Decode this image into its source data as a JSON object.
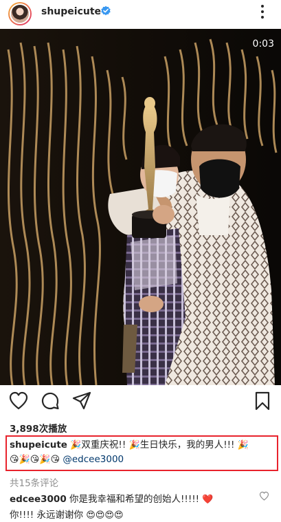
{
  "post": {
    "username": "shupeicute",
    "video_time": "0:03"
  },
  "stats": {
    "plays": "3,898次播放"
  },
  "caption": {
    "username": "shupeicute",
    "line1_part1": "双重庆祝!!",
    "line1_part2": "生日快乐，我的男人!!!",
    "mention": "@edcee3000",
    "emoji": {
      "party": "🎉",
      "kiss": "😘",
      "heart_eyes": "😍",
      "red_heart": "❤️"
    }
  },
  "comments": {
    "count_label": "共15条评论",
    "first": {
      "username": "edcee3000",
      "text_line1": "你是我幸福和希望的创始人!!!!!",
      "text_line2": "你!!!! 永远谢谢你"
    }
  },
  "colors": {
    "highlight_box": "#e8222c",
    "verified_badge": "#3897f0",
    "mention": "#00376b",
    "muted": "#8e8e8e"
  },
  "icons": [
    "verified-icon",
    "more-options-icon",
    "heart-icon",
    "comment-icon",
    "share-icon",
    "bookmark-icon",
    "like-comment-icon"
  ]
}
